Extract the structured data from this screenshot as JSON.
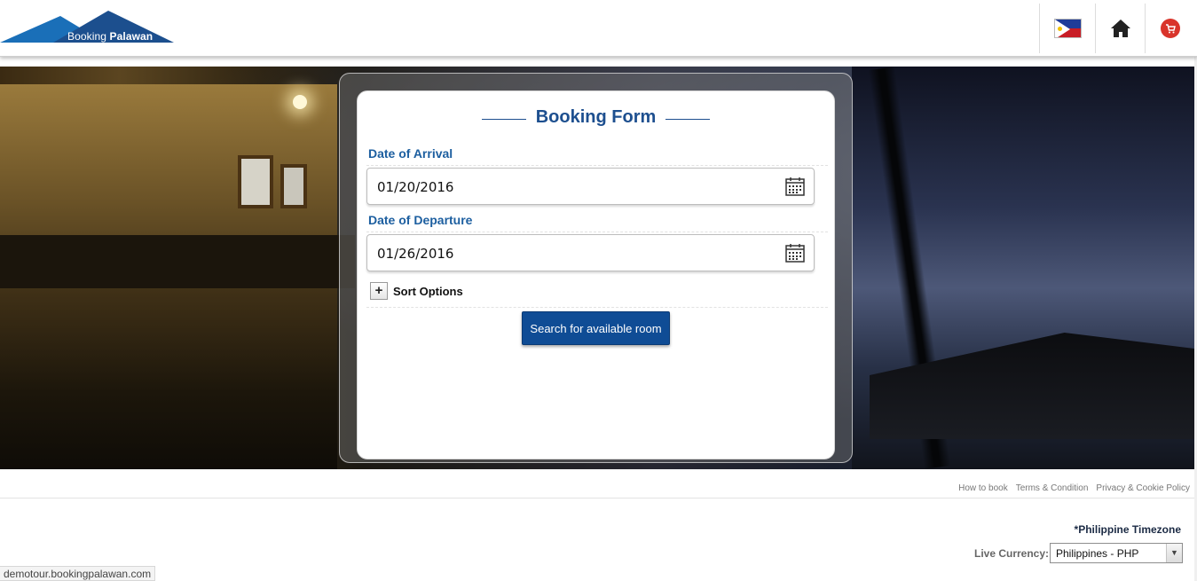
{
  "header": {
    "logo": {
      "text_prefix": "Booking",
      "text_brand": "Palawan",
      "colors": [
        "#1a6fb8",
        "#1c4f8e"
      ]
    },
    "language_flag": "flag-philippines-icon",
    "home_icon": "home-icon",
    "cart_icon": "cart-icon"
  },
  "booking_form": {
    "title": "Booking Form",
    "arrival": {
      "label": "Date of Arrival",
      "value": "01/20/2016"
    },
    "departure": {
      "label": "Date of Departure",
      "value": "01/26/2016"
    },
    "sort_options": {
      "toggle": "+",
      "label": "Sort Options"
    },
    "search_button": "Search for available room"
  },
  "footer": {
    "links": [
      "How to book",
      "Terms & Condition",
      "Privacy & Cookie Policy"
    ],
    "timezone": "*Philippine Timezone",
    "currency_label": "Live Currency:",
    "currency_value": "Philippines - PHP"
  },
  "status_bar": "demotour.bookingpalawan.com",
  "colors": {
    "accent": "#1d4f8f",
    "button": "#0f4c95",
    "label": "#1d5fa0"
  }
}
